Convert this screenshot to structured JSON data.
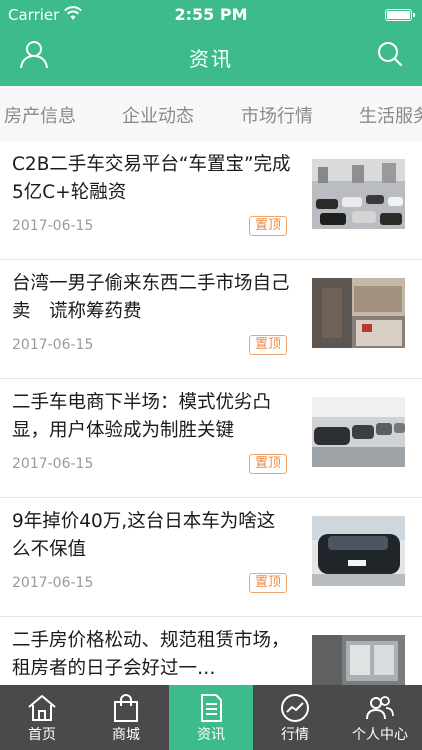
{
  "status_bar": {
    "carrier": "Carrier",
    "time": "2:55 PM"
  },
  "header": {
    "title": "资讯",
    "left_icon": "user-icon",
    "right_icon": "search-icon"
  },
  "categories": [
    {
      "label": "房产信息"
    },
    {
      "label": "企业动态"
    },
    {
      "label": "市场行情"
    },
    {
      "label": "生活服务"
    }
  ],
  "news": [
    {
      "title": "C2B二手车交易平台“车置宝”完成5亿C+轮融资",
      "date": "2017-06-15",
      "badge": "置顶"
    },
    {
      "title": "台湾一男子偷来东西二手市场自己卖　谎称筹药费",
      "date": "2017-06-15",
      "badge": "置顶"
    },
    {
      "title": "二手车电商下半场：模式优劣凸显，用户体验成为制胜关键",
      "date": "2017-06-15",
      "badge": "置顶"
    },
    {
      "title": "9年掉价40万,这台日本车为啥这么不保值",
      "date": "2017-06-15",
      "badge": "置顶"
    },
    {
      "title": "二手房价格松动、规范租赁市场，租房者的日子会好过一…",
      "date": "",
      "badge": ""
    }
  ],
  "tabbar": [
    {
      "label": "首页",
      "icon": "home-icon"
    },
    {
      "label": "商城",
      "icon": "shopping-bag-icon"
    },
    {
      "label": "资讯",
      "icon": "document-icon",
      "active": true
    },
    {
      "label": "行情",
      "icon": "trend-icon"
    },
    {
      "label": "个人中心",
      "icon": "people-icon"
    }
  ],
  "colors": {
    "accent": "#3dbb8a",
    "tabbar_bg": "#4a4a4a",
    "badge": "#ee8a43"
  }
}
